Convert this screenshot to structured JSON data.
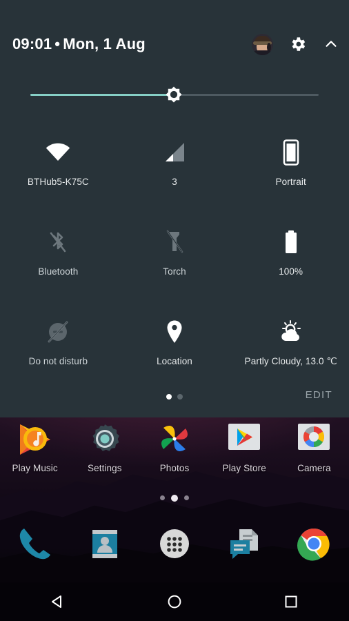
{
  "status": {
    "time": "09:01",
    "separator": "•",
    "date": "Mon, 1 Aug"
  },
  "header": {
    "avatar_name": "user-avatar",
    "settings_icon": "gear-icon",
    "collapse_icon": "chevron-up-icon"
  },
  "brightness": {
    "label": "Brightness",
    "value_percent": 49,
    "fill_color": "#86cfc6",
    "track_color": "#4e5a61",
    "thumb_icon": "brightness-sun-icon"
  },
  "quick_settings": {
    "panel_color": "#283339",
    "active_color": "#ffffff",
    "inactive_color": "#6d777d",
    "tiles": [
      [
        {
          "name": "wifi",
          "icon": "wifi-icon",
          "label": "BTHub5-K75C",
          "state": "on"
        },
        {
          "name": "mobile-data",
          "icon": "cellular-signal-icon",
          "label": "3",
          "state": "on"
        },
        {
          "name": "auto-rotate",
          "icon": "phone-portrait-icon",
          "label": "Portrait",
          "state": "on"
        }
      ],
      [
        {
          "name": "bluetooth",
          "icon": "bluetooth-off-icon",
          "label": "Bluetooth",
          "state": "off"
        },
        {
          "name": "torch",
          "icon": "flashlight-off-icon",
          "label": "Torch",
          "state": "off"
        },
        {
          "name": "battery",
          "icon": "battery-full-icon",
          "label": "100%",
          "state": "on"
        }
      ],
      [
        {
          "name": "do-not-disturb",
          "icon": "do-not-disturb-off-icon",
          "label": "Do not disturb",
          "state": "off"
        },
        {
          "name": "location",
          "icon": "location-pin-icon",
          "label": "Location",
          "state": "on"
        },
        {
          "name": "weather",
          "icon": "partly-cloudy-icon",
          "label": "Partly Cloudy, 13.0 ℃",
          "state": "on"
        }
      ]
    ],
    "page_dots": {
      "count": 2,
      "active_index": 0
    },
    "edit_label": "EDIT"
  },
  "home_screen": {
    "apps": [
      {
        "name": "play-music",
        "label": "Play Music"
      },
      {
        "name": "settings",
        "label": "Settings"
      },
      {
        "name": "photos",
        "label": "Photos"
      },
      {
        "name": "play-store",
        "label": "Play Store"
      },
      {
        "name": "camera",
        "label": "Camera"
      }
    ],
    "page_dots": {
      "count": 3,
      "active_index": 1
    },
    "dock": [
      {
        "name": "phone",
        "icon": "phone-icon"
      },
      {
        "name": "contacts",
        "icon": "contacts-icon"
      },
      {
        "name": "app-drawer",
        "icon": "apps-grid-icon"
      },
      {
        "name": "messaging",
        "icon": "messaging-icon"
      },
      {
        "name": "chrome",
        "icon": "chrome-icon"
      }
    ]
  },
  "navigation_bar": {
    "back": "back-triangle-icon",
    "home": "home-circle-icon",
    "recents": "recents-square-icon"
  }
}
